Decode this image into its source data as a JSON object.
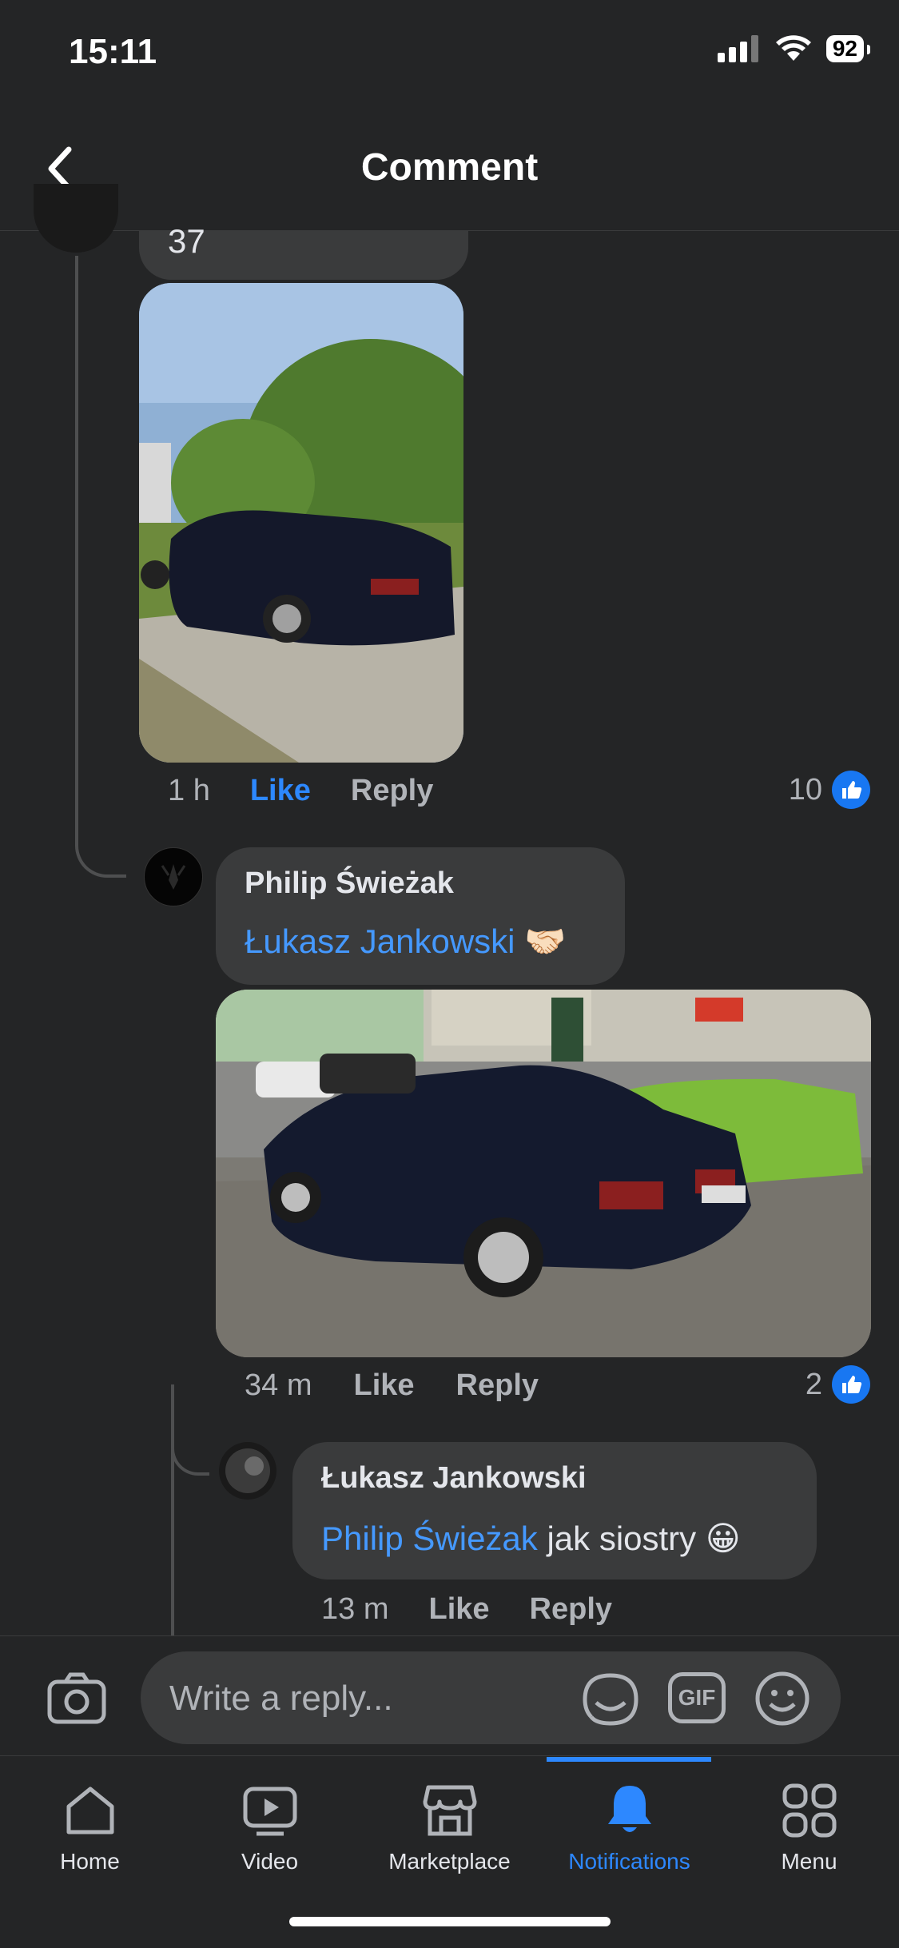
{
  "status_bar": {
    "time": "15:11",
    "battery": "92"
  },
  "header": {
    "title": "Comment"
  },
  "comment1": {
    "text_partial": "37",
    "time": "1 h",
    "like": "Like",
    "reply": "Reply",
    "reaction_count": "10"
  },
  "comment2": {
    "author": "Philip Świeżak",
    "mention": "Łukasz Jankowski",
    "emoji": "🤝🏻",
    "time": "34 m",
    "like": "Like",
    "reply": "Reply",
    "reaction_count": "2"
  },
  "comment3": {
    "author": "Łukasz Jankowski",
    "mention": "Philip Świeżak",
    "text": " jak siostry ",
    "emoji": "😀",
    "time": "13 m",
    "like": "Like",
    "reply": "Reply"
  },
  "reply_bar": {
    "placeholder": "Write a reply..."
  },
  "tabs": [
    {
      "label": "Home",
      "icon": "home-icon"
    },
    {
      "label": "Video",
      "icon": "video-icon"
    },
    {
      "label": "Marketplace",
      "icon": "marketplace-icon"
    },
    {
      "label": "Notifications",
      "icon": "bell-icon",
      "active": true
    },
    {
      "label": "Menu",
      "icon": "menu-grid-icon"
    }
  ],
  "colors": {
    "background": "#242526",
    "bubble": "#3a3b3c",
    "accent": "#2d88ff",
    "mention": "#4599ff"
  }
}
